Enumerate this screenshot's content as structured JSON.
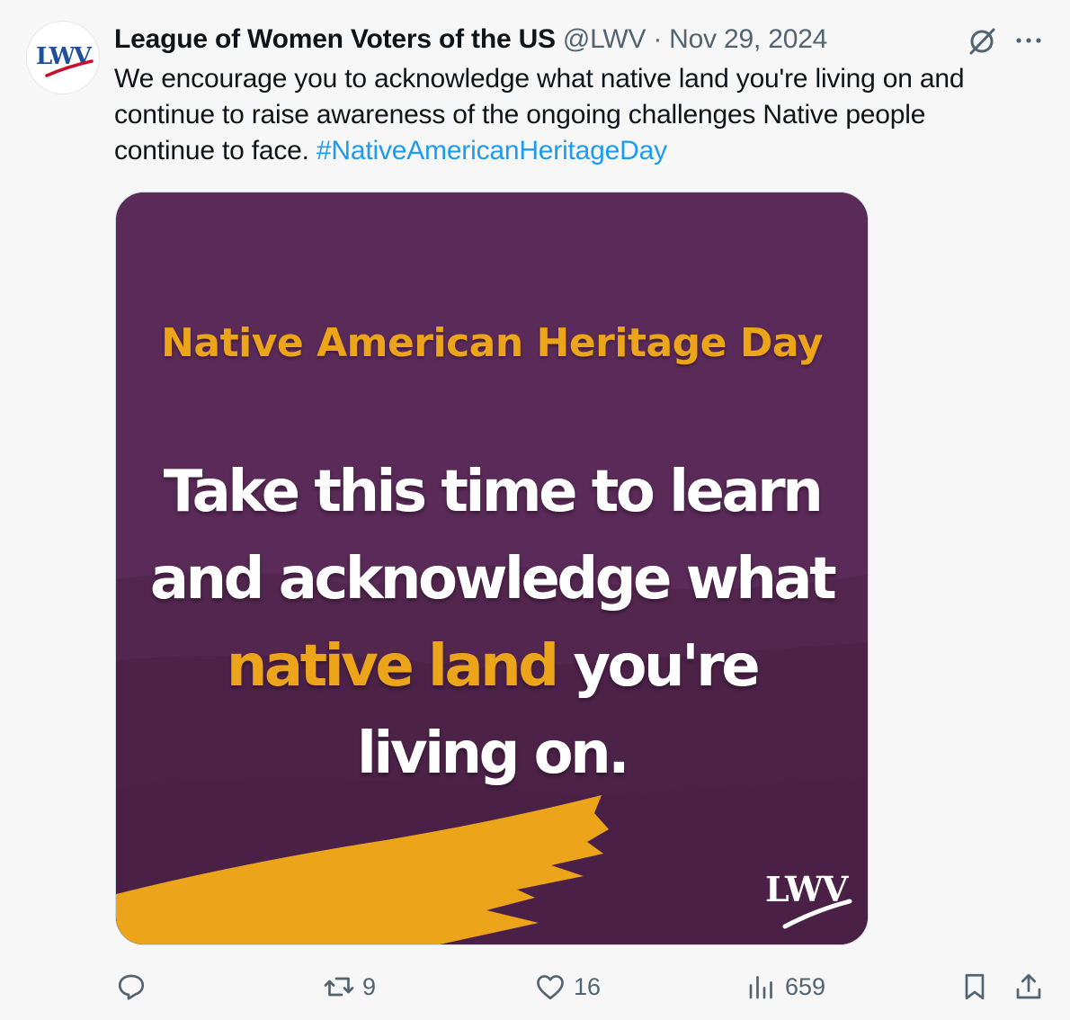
{
  "tweet": {
    "author": {
      "display_name": "League of Women Voters of the US",
      "handle": "@LWV",
      "avatar_label": "LWV"
    },
    "separator": "·",
    "date": "Nov 29, 2024",
    "text_main": "We encourage you to acknowledge what native land you're living on and continue to raise awareness of the ongoing challenges Native people continue to face.",
    "hashtag": "#NativeAmericanHeritageDay",
    "media": {
      "heading": "Native American Heritage Day",
      "body_part1": "Take this time to learn and acknowledge what",
      "body_highlight": "native land",
      "body_part2": "you're living on.",
      "logo": "LWV",
      "colors": {
        "background": "#5a2a58",
        "accent": "#eca51b",
        "text": "#ffffff"
      }
    },
    "actions": {
      "reply_count": "",
      "retweet_count": "9",
      "like_count": "16",
      "views_count": "659"
    },
    "colors": {
      "link": "#1d9bf0",
      "secondary_text": "#536471",
      "primary_text": "#0f1419"
    },
    "icons": [
      "grok-icon",
      "more-icon",
      "reply-icon",
      "retweet-icon",
      "like-icon",
      "views-icon",
      "bookmark-icon",
      "share-icon"
    ]
  }
}
